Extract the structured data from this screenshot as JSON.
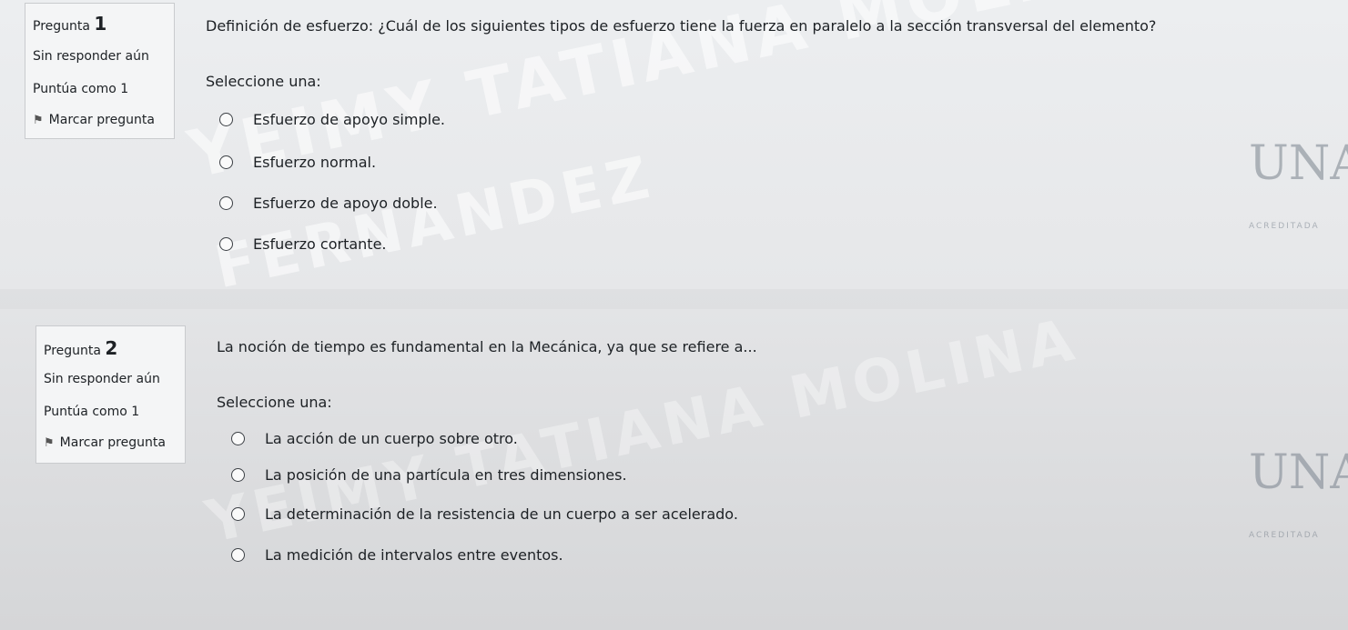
{
  "questions": [
    {
      "label": "Pregunta",
      "number": "1",
      "status": "Sin responder aún",
      "score": "Puntúa como 1",
      "flag": "Marcar pregunta",
      "text": "Definición de esfuerzo: ¿Cuál de los siguientes tipos de esfuerzo tiene la fuerza en paralelo a la sección transversal del elemento?",
      "prompt": "Seleccione una:",
      "options": [
        "Esfuerzo de apoyo simple.",
        "Esfuerzo normal.",
        "Esfuerzo de apoyo doble.",
        "Esfuerzo cortante."
      ]
    },
    {
      "label": "Pregunta",
      "number": "2",
      "status": "Sin responder aún",
      "score": "Puntúa como 1",
      "flag": "Marcar pregunta",
      "text": "La noción de tiempo es fundamental en la Mecánica, ya que se refiere a...",
      "prompt": "Seleccione una:",
      "options": [
        "La acción de un cuerpo sobre otro.",
        "La posición de una partícula en tres dimensiones.",
        "La determinación de la resistencia de un cuerpo a ser acelerado.",
        "La medición de intervalos entre eventos."
      ]
    }
  ],
  "watermark": {
    "line1": "YEIMY TATIANA MOLINA",
    "line2": "FERNANDEZ"
  },
  "logo": {
    "mark": "UNA",
    "badge": "ACREDITADA"
  }
}
